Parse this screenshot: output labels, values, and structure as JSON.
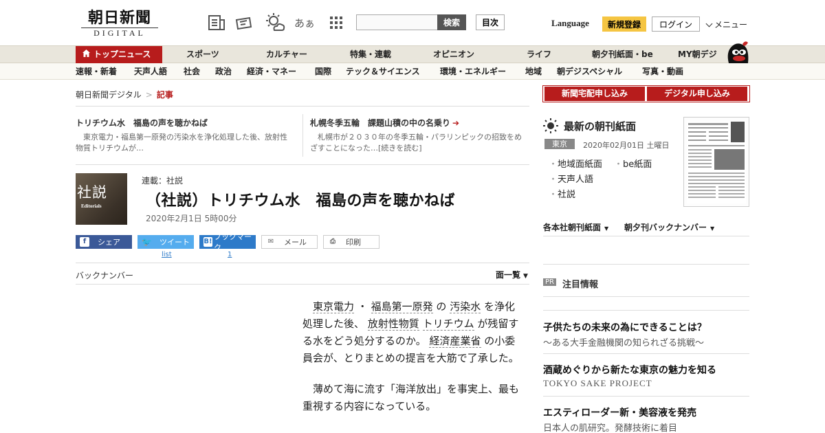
{
  "header": {
    "logo_jp": "朝日新聞",
    "logo_en": "DIGITAL",
    "icons": [
      "newspaper-icon",
      "delivery-icon",
      "weather-icon",
      "font-size-icon",
      "grid-icon"
    ],
    "font_size_label": "あぁ",
    "search_placeholder": "",
    "search_button": "検索",
    "index_button": "目次",
    "language": "Language",
    "register": "新規登録",
    "login": "ログイン",
    "menu": "メニュー"
  },
  "nav_primary": [
    {
      "label": "トップニュース"
    },
    {
      "label": "スポーツ"
    },
    {
      "label": "カルチャー"
    },
    {
      "label": "特集・連載"
    },
    {
      "label": "オピニオン"
    },
    {
      "label": "ライフ"
    },
    {
      "label": "朝夕刊紙面・be"
    },
    {
      "label": "MY朝デジ"
    }
  ],
  "nav_secondary": [
    {
      "label": "速報・新着"
    },
    {
      "label": "天声人語"
    },
    {
      "label": "社会"
    },
    {
      "label": "政治"
    },
    {
      "label": "経済・マネー"
    },
    {
      "label": "国際"
    },
    {
      "label": "テック＆サイエンス"
    },
    {
      "label": "環境・エネルギー"
    },
    {
      "label": "地域"
    },
    {
      "label": "朝デジスペシャル"
    },
    {
      "label": "写真・動画"
    }
  ],
  "breadcrumb": {
    "home": "朝日新聞デジタル",
    "sep": ">",
    "current": "記事"
  },
  "related": [
    {
      "title": "トリチウム水　福島の声を聴かねば",
      "text": "東京電力・福島第一原発の汚染水を浄化処理した後、放射性物質トリチウムが…"
    },
    {
      "title": "札幌冬季五輪　課題山積の中の名乗り",
      "text": "札幌市が２０３０年の冬季五輪・パラリンピックの招致をめざすことになった…[続きを読む]"
    }
  ],
  "article": {
    "thumb_jp": "社説",
    "thumb_en": "Editorials",
    "series": "連載：社説",
    "title": "（社説）トリチウム水　福島の声を聴かねば",
    "date": "2020年2月1日 5時00分",
    "share": {
      "facebook": "シェア",
      "twitter": "ツイート",
      "hatena": "ブックマーク",
      "mail": "メール",
      "print": "印刷",
      "twitter_count": "list",
      "hatena_count": "1"
    },
    "backnumber": "バックナンバー",
    "page_list": "面一覧",
    "para1": [
      "東京電力",
      "・",
      "福島第一原発",
      "の",
      "汚染水",
      "を浄化処理した後、",
      "放射性物質",
      "トリチウム",
      "が残留する水をどう処分するのか。",
      "経済産業省",
      "の小委員会が、とりまとめの提言を大筋で了承した。"
    ],
    "para2": "薄めて海に流す「海洋放出」を事実上、最も重視する内容になっている。"
  },
  "sidebar": {
    "subscribe_home": "新聞宅配申し込み",
    "subscribe_digital": "デジタル申し込み",
    "paper_title": "最新の朝刊紙面",
    "edition": "東京",
    "paper_date": "2020年02月01日 土曜日",
    "links": [
      "地域面紙面",
      "be紙面",
      "天声人語",
      "社説"
    ],
    "dropdown1": "各本社朝刊紙面",
    "dropdown2": "朝夕刊バックナンバー",
    "pr_label": "PR",
    "pr_title": "注目情報",
    "ads": [
      {
        "title": "子供たちの未来の為にできることは？",
        "sub": "～ある大手金融機関の知られざる挑戦～"
      },
      {
        "title": "酒蔵めぐりから新たな東京の魅力を知る",
        "sub": "TOKYO SAKE PROJECT"
      },
      {
        "title": "エスティローダー新・美容液を発売",
        "sub": "日本人の肌研究。発酵技術に着目"
      }
    ]
  },
  "colors": {
    "brand_red": "#b71c1c",
    "register_yellow": "#f5c542",
    "nav_bg": "#e9e6dc"
  }
}
